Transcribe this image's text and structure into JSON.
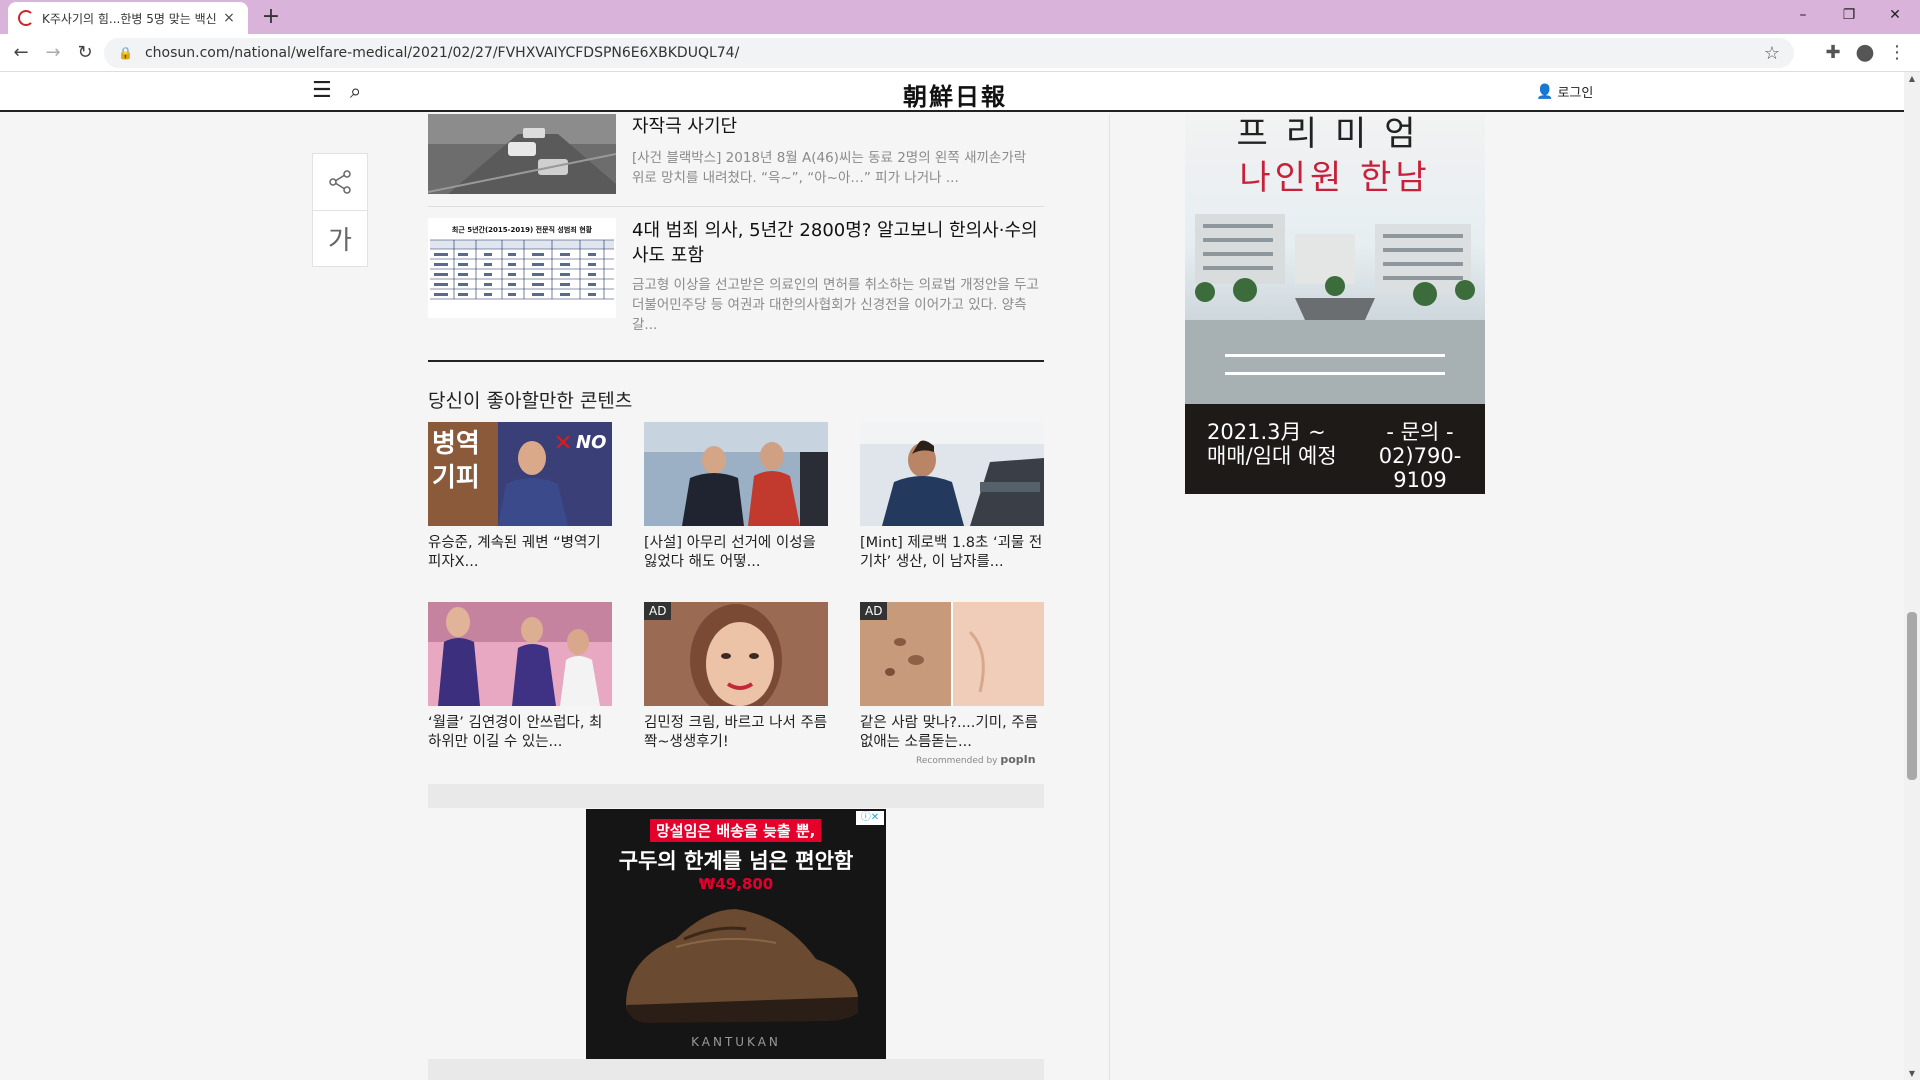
{
  "browser": {
    "tab_title": "K주사기의 힘...한병 5명 맞는 백신",
    "tab_close": "×",
    "new_tab": "+",
    "window_minimize": "–",
    "window_restore": "❐",
    "window_close": "✕",
    "back": "←",
    "forward": "→",
    "reload": "↻",
    "url": "chosun.com/national/welfare-medical/2021/02/27/FVHXVAIYCFDSPN6E6XBKDUQL74/",
    "bookmark": "☆",
    "extensions": "✚",
    "profile": "●",
    "menu": "⋮"
  },
  "site": {
    "logo": "朝鮮日報",
    "login": "로그인",
    "menu_icon": "☰",
    "search_icon": "⌕"
  },
  "tools": {
    "share_icon": "share-icon",
    "font_size": "가"
  },
  "articles": [
    {
      "title": "자작극 사기단",
      "desc": "[사건 블랙박스] 2018년 8월 A(46)씨는 동료 2명의 왼쪽 새끼손가락 위로 망치를 내려쳤다. “윽~”, “아~아…” 피가 나거나 ..."
    },
    {
      "title": "4대 범죄 의사, 5년간 2800명? 알고보니 한의사·수의사도 포함",
      "desc": "금고형 이상을 선고받은 의료인의 면허를 취소하는 의료법 개정안을 두고 더불어민주당 등 여권과 대한의사협회가 신경전을 이어가고 있다. 양측 갈...",
      "table_caption": "최근 5년간(2015-2019) 전문직 성범죄 현황"
    }
  ],
  "recommend": {
    "title": "당신이 좋아할만한 콘텐츠",
    "recommended_by": "Recommended by",
    "recommended_brand": "popIn",
    "cards": [
      {
        "caption": "유승준, 계속된 궤변 “병역기피자X...",
        "ad": false,
        "thumb_text": "병역 기피 ✕NO"
      },
      {
        "caption": "[사설] 아무리 선거에 이성을 잃었다 해도 어떻...",
        "ad": false
      },
      {
        "caption": "[Mint] 제로백 1.8초 ‘괴물 전기차’ 생산, 이 남자를...",
        "ad": false
      },
      {
        "caption": "‘월클’ 김연경이 안쓰럽다, 최하위만 이길 수 있는...",
        "ad": false
      },
      {
        "caption": "김민정 크림, 바르고 나서 주름 쫙~생생후기!",
        "ad": true
      },
      {
        "caption": "같은 사람 맞나?....기미, 주름 없애는 소름돋는...",
        "ad": true
      }
    ],
    "ad_label": "AD"
  },
  "ads": {
    "shoe": {
      "pill": "망설임은 배송을 늦출 뿐,",
      "headline": "구두의 한계를 넘은 편안함",
      "price": "₩49,800",
      "brand": "KANTUKAN",
      "adchoice": "ⓘ✕"
    },
    "realestate": {
      "line1": "프리미엄",
      "line2": "나인원 한남",
      "date_l1": "2021.3月 ~",
      "date_l2": "매매/임대 예정",
      "contact_l1": "- 문의 -",
      "contact_l2": "02)790-9109"
    }
  }
}
